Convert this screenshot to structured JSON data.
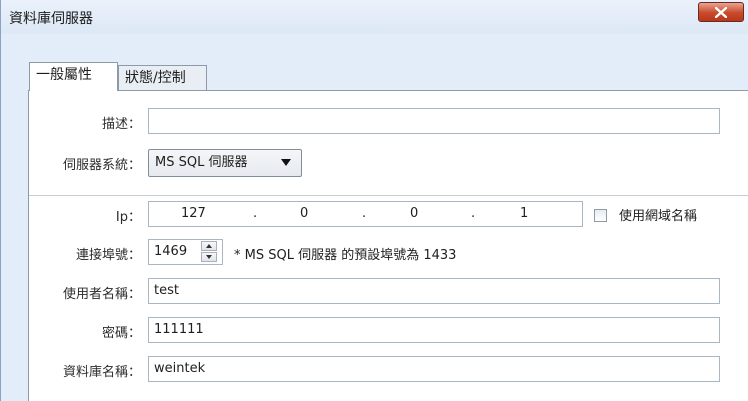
{
  "window": {
    "title": "資料庫伺服器"
  },
  "tabs": [
    {
      "label": "一般屬性"
    },
    {
      "label": "狀態/控制"
    }
  ],
  "form": {
    "description": {
      "label": "描述：",
      "value": ""
    },
    "server_system": {
      "label": "伺服器系統：",
      "value": "MS SQL 伺服器"
    },
    "ip": {
      "label": "Ip：",
      "octets": [
        "127",
        "0",
        "0",
        "1"
      ],
      "separator": "."
    },
    "use_domain_name": {
      "label": "使用網域名稱",
      "checked": false
    },
    "port": {
      "label": "連接埠號：",
      "value": "1469",
      "note": "* MS SQL 伺服器 的預設埠號為 1433"
    },
    "username": {
      "label": "使用者名稱：",
      "value": "test"
    },
    "password": {
      "label": "密碼：",
      "value": "111111"
    },
    "database": {
      "label": "資料庫名稱：",
      "value": "weintek"
    }
  },
  "colors": {
    "close_button": "#c9492a",
    "window_bg": "#e3edf9",
    "panel_bg": "#ffffff"
  }
}
